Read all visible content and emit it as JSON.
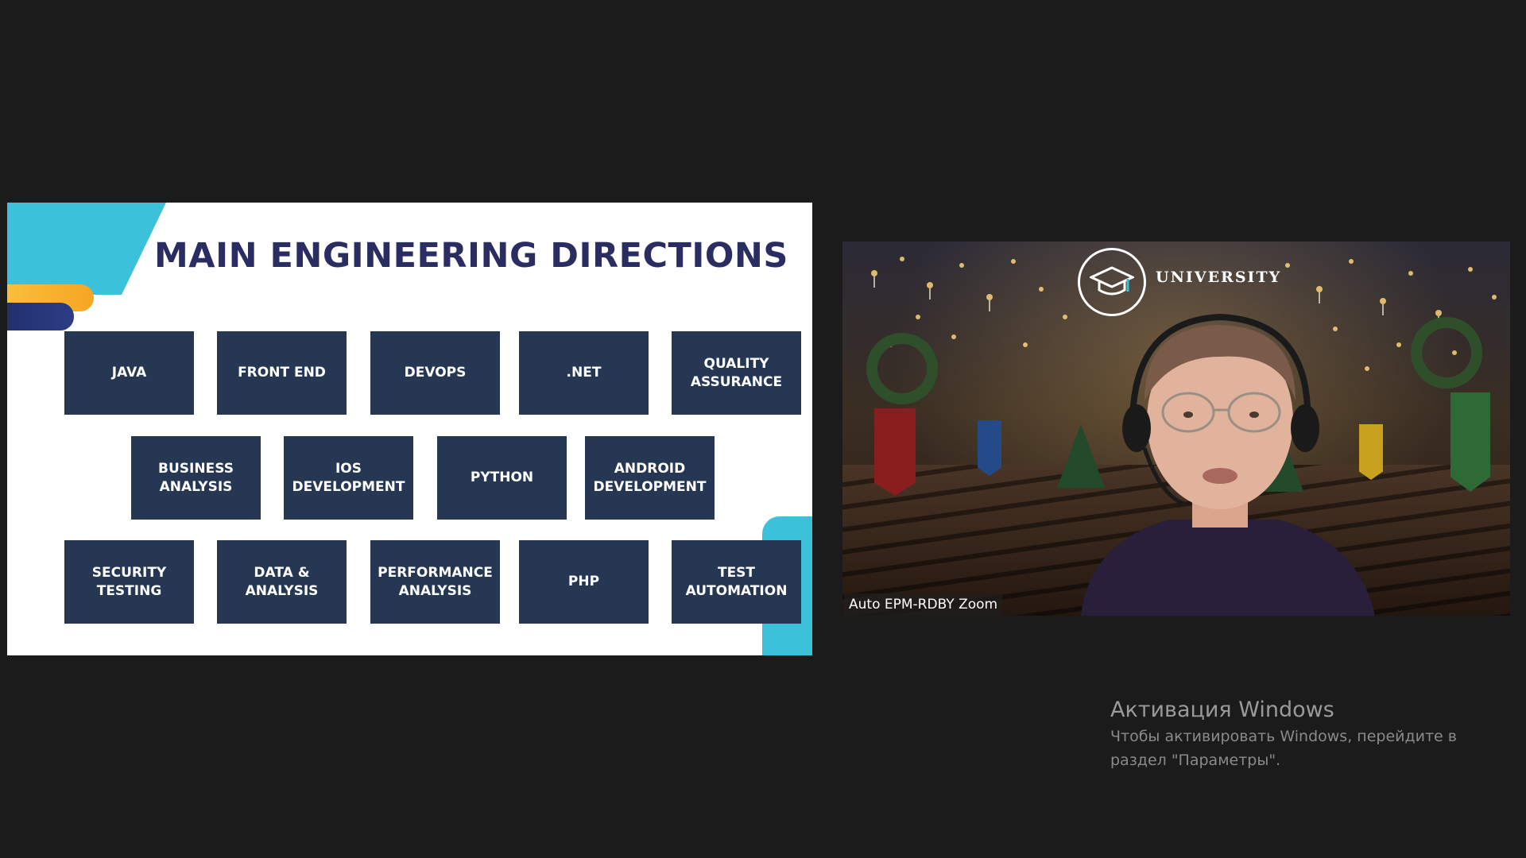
{
  "slide": {
    "title": "MAIN ENGINEERING DIRECTIONS",
    "tiles": [
      "JAVA",
      "FRONT END",
      "DEVOPS",
      ".NET",
      "QUALITY\nASSURANCE",
      "BUSINESS\nANALYSIS",
      "IOS\nDEVELOPMENT",
      "PYTHON",
      "ANDROID\nDEVELOPMENT",
      "SECURITY\nTESTING",
      "DATA &\nANALYSIS",
      "PERFORMANCE\nANALYSIS",
      "PHP",
      "TEST\nAUTOMATION"
    ],
    "colors": {
      "tile": "#263754",
      "title": "#2a2d62",
      "accent_cyan": "#3bc1d9",
      "accent_yellow": "#f5a623"
    }
  },
  "video": {
    "participant_name": "Auto EPM-RDBY Zoom",
    "background_logo_text": "UNIVERSITY",
    "background_logo_icon": "graduation-cap-icon"
  },
  "activation": {
    "title": "Активация Windows",
    "text": "Чтобы активировать Windows, перейдите в раздел \"Параметры\"."
  }
}
